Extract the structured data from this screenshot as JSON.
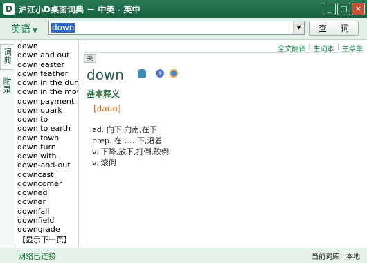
{
  "window": {
    "app_icon": "D",
    "title": "沪江小D桌面词典 － 中英 - 英中",
    "controls": [
      "_",
      "□",
      "×"
    ]
  },
  "toolbar": {
    "language": "英语",
    "search_value": "down",
    "query_label": "查 词"
  },
  "side_tabs": [
    "词典",
    "附录"
  ],
  "word_list": [
    "down",
    "down and out",
    "down easter",
    "down feather",
    "down in the dumps",
    "down in the mouth",
    "down payment",
    "down quark",
    "down to",
    "down to earth",
    "down town",
    "down turn",
    "down with",
    "down-and-out",
    "downcast",
    "downcomer",
    "downed",
    "downer",
    "downfall",
    "downfield",
    "downgrade"
  ],
  "next_page": "【显示下一页】",
  "links": [
    "全文翻译",
    "生词本",
    "主菜单"
  ],
  "detail": {
    "source_badge": "英",
    "headword": "down",
    "section_title": "基本释义",
    "phonetic": "[daun]",
    "definitions": [
      "ad. 向下,向南,在下",
      "prep. 在……下,沿着",
      "v. 下降,放下,打倒,砍倒",
      "v. 滚倒"
    ]
  },
  "status": {
    "left": "网络已连接",
    "right": "当前词库：本地"
  },
  "icons": [
    "app-d-icon",
    "speaker-icon",
    "add-icon",
    "ie-icon",
    "chevron-down-icon"
  ],
  "colors": {
    "title_bar": "#1b6a46",
    "accent": "#1a8a4a",
    "headword": "#2a5d4d",
    "phonetic": "#d86a10"
  }
}
